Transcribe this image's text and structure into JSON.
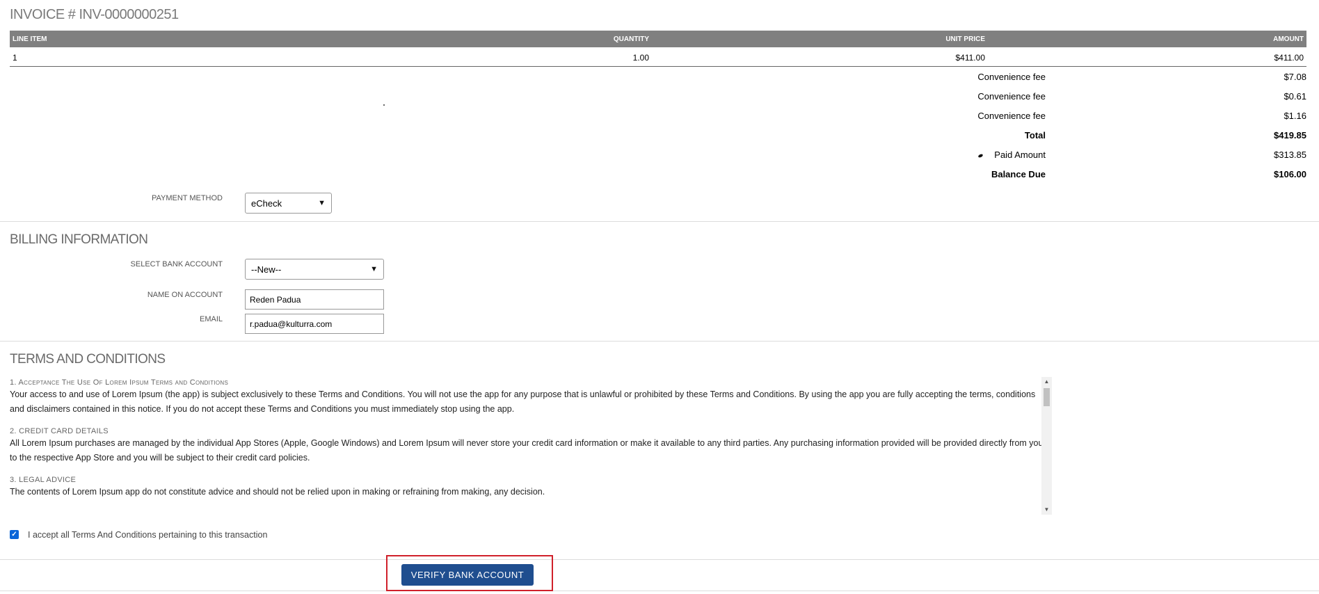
{
  "invoice": {
    "title": "INVOICE # INV-0000000251"
  },
  "table": {
    "headers": [
      "LINE ITEM",
      "QUANTITY",
      "UNIT PRICE",
      "AMOUNT"
    ],
    "rows": [
      {
        "line_item": "1",
        "quantity": "1.00",
        "unit_price": "$411.00",
        "amount": "$411.00"
      }
    ]
  },
  "summary": [
    {
      "label": "Convenience fee",
      "value": "$7.08"
    },
    {
      "label": "Convenience fee",
      "value": "$0.61"
    },
    {
      "label": "Convenience fee",
      "value": "$1.16"
    },
    {
      "label": "Total",
      "value": "$419.85"
    },
    {
      "label": "Paid Amount",
      "value": "$313.85"
    },
    {
      "label": "Balance Due",
      "value": "$106.00"
    }
  ],
  "payment": {
    "label": "PAYMENT METHOD",
    "value": "eCheck"
  },
  "billing": {
    "title": "BILLING INFORMATION",
    "bank_label": "SELECT BANK ACCOUNT",
    "bank_value": "--New--",
    "name_label": "NAME ON ACCOUNT",
    "name_value": "Reden Padua",
    "email_label": "EMAIL",
    "email_value": "r.padua@kulturra.com"
  },
  "terms": {
    "title": "TERMS AND CONDITIONS",
    "sections": [
      {
        "head": "1. Acceptance The Use Of Lorem Ipsum Terms and Conditions",
        "body": "Your access to and use of Lorem Ipsum (the app) is subject exclusively to these Terms and Conditions. You will not use the app for any purpose that is unlawful or prohibited by these Terms and Conditions. By using the app you are fully accepting the terms, conditions and disclaimers contained in this notice. If you do not accept these Terms and Conditions you must immediately stop using the app."
      },
      {
        "head": "2. CREDIT CARD DETAILS",
        "body": "All Lorem Ipsum purchases are managed by the individual App Stores (Apple, Google Windows) and Lorem Ipsum will never store your credit card information or make it available to any third parties. Any purchasing information provided will be provided directly from you to the respective App Store and you will be subject to their credit card policies."
      },
      {
        "head": "3. LEGAL ADVICE",
        "body": "The contents of Lorem Ipsum app do not constitute advice and should not be relied upon in making or refraining from making, any decision."
      }
    ],
    "accept_label": "I accept all Terms And Conditions pertaining to this transaction",
    "accept_checked": true
  },
  "actions": {
    "verify_label": "VERIFY BANK ACCOUNT"
  },
  "colors": {
    "header_bg": "#808080",
    "button_bg": "#1f4e8f",
    "highlight_border": "#d0202a",
    "checkbox": "#0a65d8"
  }
}
